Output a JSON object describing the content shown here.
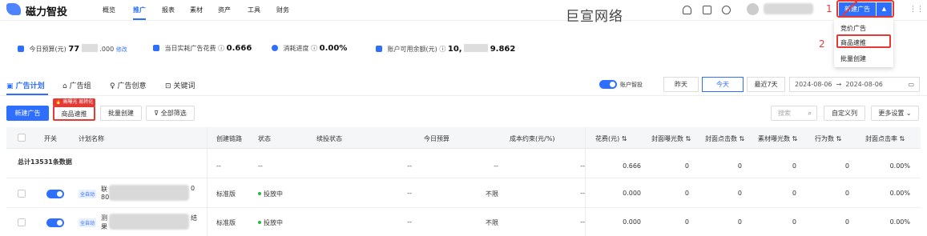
{
  "app": {
    "logo_text": "磁力智投"
  },
  "nav": {
    "items": [
      "概览",
      "推广",
      "报表",
      "素材",
      "资产",
      "工具",
      "财务"
    ],
    "active": "推广"
  },
  "watermark": "巨宣网络",
  "header": {
    "new_button": "新建广告",
    "annotation_1": "1",
    "annotation_2": "2"
  },
  "dropdown": {
    "items": [
      "竞价广告",
      "商品速推",
      "批量创建"
    ],
    "highlighted": "商品速推"
  },
  "stats": {
    "budget_label": "今日预算(元)",
    "budget_value_prefix": "77",
    "budget_value_suffix": ".000",
    "budget_edit": "修改",
    "spend_label": "当日实耗广告花费",
    "spend_value": "0.666",
    "progress_label": "消耗进度",
    "progress_value": "0.00%",
    "balance_label": "账户可用余额(元)",
    "balance_prefix": "10,",
    "balance_suffix": "9.862"
  },
  "tabs": [
    "广告计划",
    "广告组",
    "广告创意",
    "关键词"
  ],
  "smart": {
    "toggle_label": "账户智投"
  },
  "dates": {
    "yesterday": "昨天",
    "today": "今天",
    "last7": "最近7天",
    "start": "2024-08-06",
    "sep": "→",
    "end": "2024-08-06"
  },
  "actions": {
    "new_ad": "新建广告",
    "quick_promote": "商品速推",
    "batch_create": "批量创建",
    "all_filter": "全部筛选",
    "badge": "高曝光 易转化",
    "search_placeholder": "搜索",
    "custom_cols": "自定义列",
    "more_settings": "更多设置"
  },
  "table": {
    "headers": [
      "开关",
      "计划名称",
      "创建链路",
      "状态",
      "续投状态",
      "今日预算",
      "成本约束(元/%)",
      "花费(元)",
      "封面曝光数",
      "封面点击数",
      "素材曝光数",
      "行为数",
      "封面点击率"
    ],
    "total": {
      "label": "总计13531条数据",
      "chain": "--",
      "status": "--",
      "renew": "--",
      "budget": "--",
      "cost": "--",
      "spend": "0.666",
      "imp": "0",
      "click": "0",
      "mimp": "0",
      "act": "0",
      "ctr": "0.00%"
    },
    "rows": [
      {
        "tag": "全自动",
        "name": "联",
        "name2": "0",
        "name3": "80",
        "chain": "标准版",
        "status": "投放中",
        "renew": "--",
        "budget": "不限",
        "cost": "--",
        "spend": "0.000",
        "imp": "0",
        "click": "0",
        "mimp": "0",
        "act": "0",
        "ctr": "0.00%"
      },
      {
        "tag": "全自动",
        "name": "测",
        "name2": "结",
        "name3": "果",
        "chain": "标准版",
        "status": "投放中",
        "renew": "--",
        "budget": "不限",
        "cost": "--",
        "spend": "0.000",
        "imp": "0",
        "click": "0",
        "mimp": "0",
        "act": "0",
        "ctr": "0.00%"
      }
    ]
  }
}
